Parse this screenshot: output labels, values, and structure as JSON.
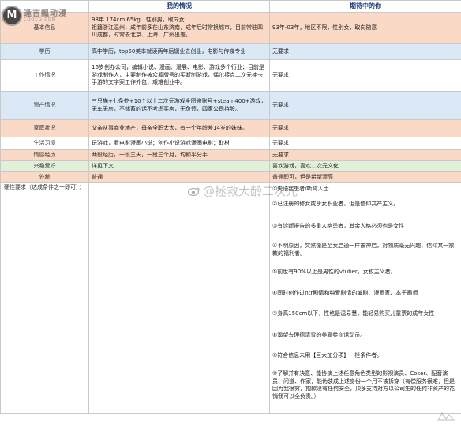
{
  "headers": {
    "mine": "我的情况",
    "expect": "期待中的你"
  },
  "rows": [
    {
      "label": "基本信息",
      "mine": "98年 174cm 65kg　性别男，取向女\n祖籍浙江温州，成年前多在山东济南，成年后时常换城市，目前常驻四川成都，时常去北京、上海，广州出差。",
      "expect": "93年-03年，地区不限，性别女，取向随意"
    },
    {
      "label": "学历",
      "mine": "高中学历，top50美本就读两年后辍业去创业，电影与传媒专业",
      "expect": "无要求"
    },
    {
      "label": "工作情况",
      "mine": "16岁创办公司，编辑小说、漫画、漫展、电影、游戏多个行业；目前是游戏制作人，主要制作被众筹版号的买断制游戏，偶尔接点二次元抽卡手游的文字案工作外包，艰难创业中。",
      "expect": "无要求"
    },
    {
      "label": "资产情况",
      "mine": "三只猫+七条蛇+10个以上二次元游戏全图鉴账号+steam400+游戏，无车无房，不储蓄的话不考虑买房，无负债，四家公司持股。",
      "expect": "无要求"
    },
    {
      "label": "家庭状况",
      "mine": "父亲从事商业地产，母亲全职太太，有一个年龄差14岁的妹妹。",
      "expect": "无要求"
    },
    {
      "label": "生活习惯",
      "mine": "玩游戏，看电影漫画小说；创作小说游戏漫画电影；取材",
      "expect": "无要求"
    },
    {
      "label": "情感经历",
      "mine": "两段经历，一段三天，一段三个月，均和平分手",
      "expect": "无要求"
    },
    {
      "label": "兴趣爱好",
      "mine": "详见下文",
      "expect": "喜欢游戏，喜欢二次元文化"
    },
    {
      "label": "外貌",
      "mine": "普通",
      "expect": "普通即可，但是希望漂亮"
    }
  ],
  "hard": {
    "label": "硬性要求（达成条件之一即可）：",
    "items": [
      "①失语症患者/听障人士",
      "②已注册的修女或孪女职业者，但是信仰共产主义。",
      "③有诊断报告的多重人格患者，其余人格必须也是女性",
      "④不明原因，突然像是至女启通一样被神启，对物质毫无兴趣、信仰某一宗教的福利者。",
      "⑤前世有90%以上是男性的vtuber，女权主义者。",
      "⑥同时创作过ntr剧情和纯爱剧情的编剧、漫画家、本子画师",
      "⑦身高150cm以下，性格是温易慧，能轻易购买儿童票的成年女性",
      "⑧渴望去理德清雪的美嘉柔血运动员。",
      "⑨符合信息未用【巨大加分项】一栏条件者。",
      "⑩了解并有决意、能协演上述任意角色类型的影视演员、Coser、配音演员、问道、作家，能伪装成上述身份一个月不被拆穿（有偿服务很难，但是因为我很穷，抱歉没有任何安全，顶多支持对方以公司生的任何非资产的花销我可以全负责。）"
    ]
  },
  "watermark": "@拯救大龄二次元",
  "logo": {
    "cn": "逢吉瓢动漫",
    "en": "COOCG.COM",
    "letter": "M"
  }
}
